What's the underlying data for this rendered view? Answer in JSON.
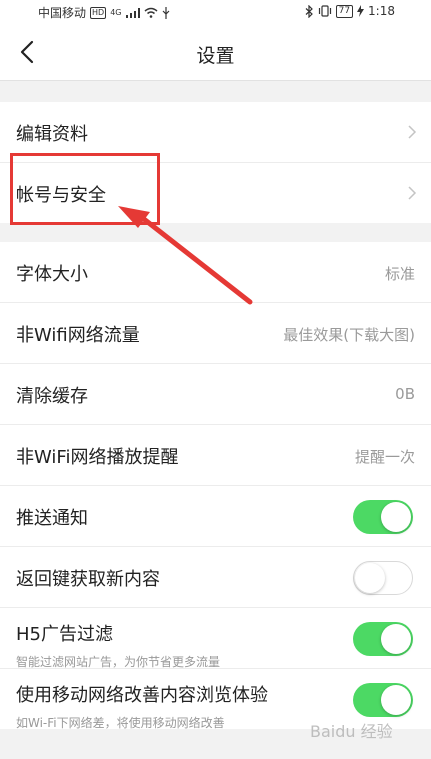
{
  "status": {
    "carrier": "中国移动",
    "hd": "HD",
    "network": "4G",
    "battery": "77",
    "time": "1:18"
  },
  "nav": {
    "title": "设置"
  },
  "group1": {
    "items": [
      {
        "label": "编辑资料"
      },
      {
        "label": "帐号与安全"
      }
    ]
  },
  "group2": {
    "items": [
      {
        "label": "字体大小",
        "value": "标准"
      },
      {
        "label": "非Wifi网络流量",
        "value": "最佳效果(下载大图)"
      },
      {
        "label": "清除缓存",
        "value": "0B"
      },
      {
        "label": "非WiFi网络播放提醒",
        "value": "提醒一次"
      },
      {
        "label": "推送通知",
        "toggle": true
      },
      {
        "label": "返回键获取新内容",
        "toggle": false
      },
      {
        "label": "H5广告过滤",
        "subtitle": "智能过滤网站广告，为你节省更多流量",
        "toggle": true
      },
      {
        "label": "使用移动网络改善内容浏览体验",
        "subtitle": "如Wi-Fi下网络差，将使用移动网络改善",
        "toggle": true
      }
    ]
  },
  "watermark": {
    "text": "Baidu 经验"
  },
  "colors": {
    "toggle_on": "#4cd964",
    "annotation": "#e53935"
  }
}
